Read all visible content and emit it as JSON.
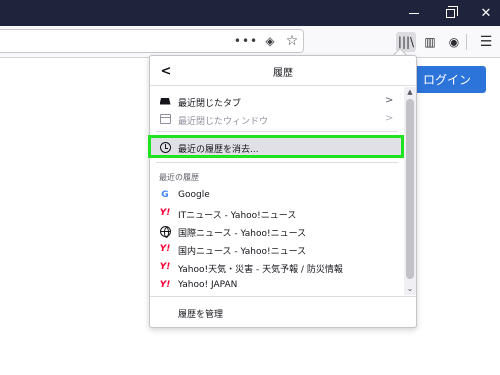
{
  "window": {
    "minimize_icon": "minimize-icon",
    "maximize_icon": "maximize-icon",
    "close_glyph": "✕"
  },
  "toolbar": {
    "more_glyph": "•••",
    "pocket_glyph": "◈",
    "bookmark_glyph": "☆",
    "library_glyph": "|||\\",
    "sidebar_glyph": "▥",
    "account_glyph": "◉",
    "menu_glyph": "☰"
  },
  "page": {
    "login_label": "ログイン",
    "login_color": "#2d74da"
  },
  "history_panel": {
    "back_glyph": "<",
    "title": "履歴",
    "items": [
      {
        "label": "最近閉じたタブ",
        "icon": "tab-icon",
        "chevron": ">"
      },
      {
        "label": "最近閉じたウィンドウ",
        "icon": "window-icon",
        "chevron": ">"
      }
    ],
    "clear_label": "最近の履歴を消去...",
    "recent_title": "最近の履歴",
    "recent": [
      {
        "label": "Google",
        "icon": "google-icon",
        "glyph": "G"
      },
      {
        "label": "ITニュース - Yahoo!ニュース",
        "icon": "yahoo-icon",
        "glyph": "Y!"
      },
      {
        "label": "国際ニュース - Yahoo!ニュース",
        "icon": "globe-icon",
        "glyph": ""
      },
      {
        "label": "国内ニュース - Yahoo!ニュース",
        "icon": "yahoo-icon",
        "glyph": "Y!"
      },
      {
        "label": "Yahoo!天気・災害 - 天気予報 / 防災情報",
        "icon": "yahoo-icon",
        "glyph": "Y!"
      },
      {
        "label": "Yahoo! JAPAN",
        "icon": "yahoo-icon",
        "glyph": "Y!"
      }
    ],
    "manage_label": "履歴を管理",
    "scroll_up_glyph": "▲",
    "scroll_down_glyph": "⌄",
    "highlight_color": "#1fe31f"
  }
}
